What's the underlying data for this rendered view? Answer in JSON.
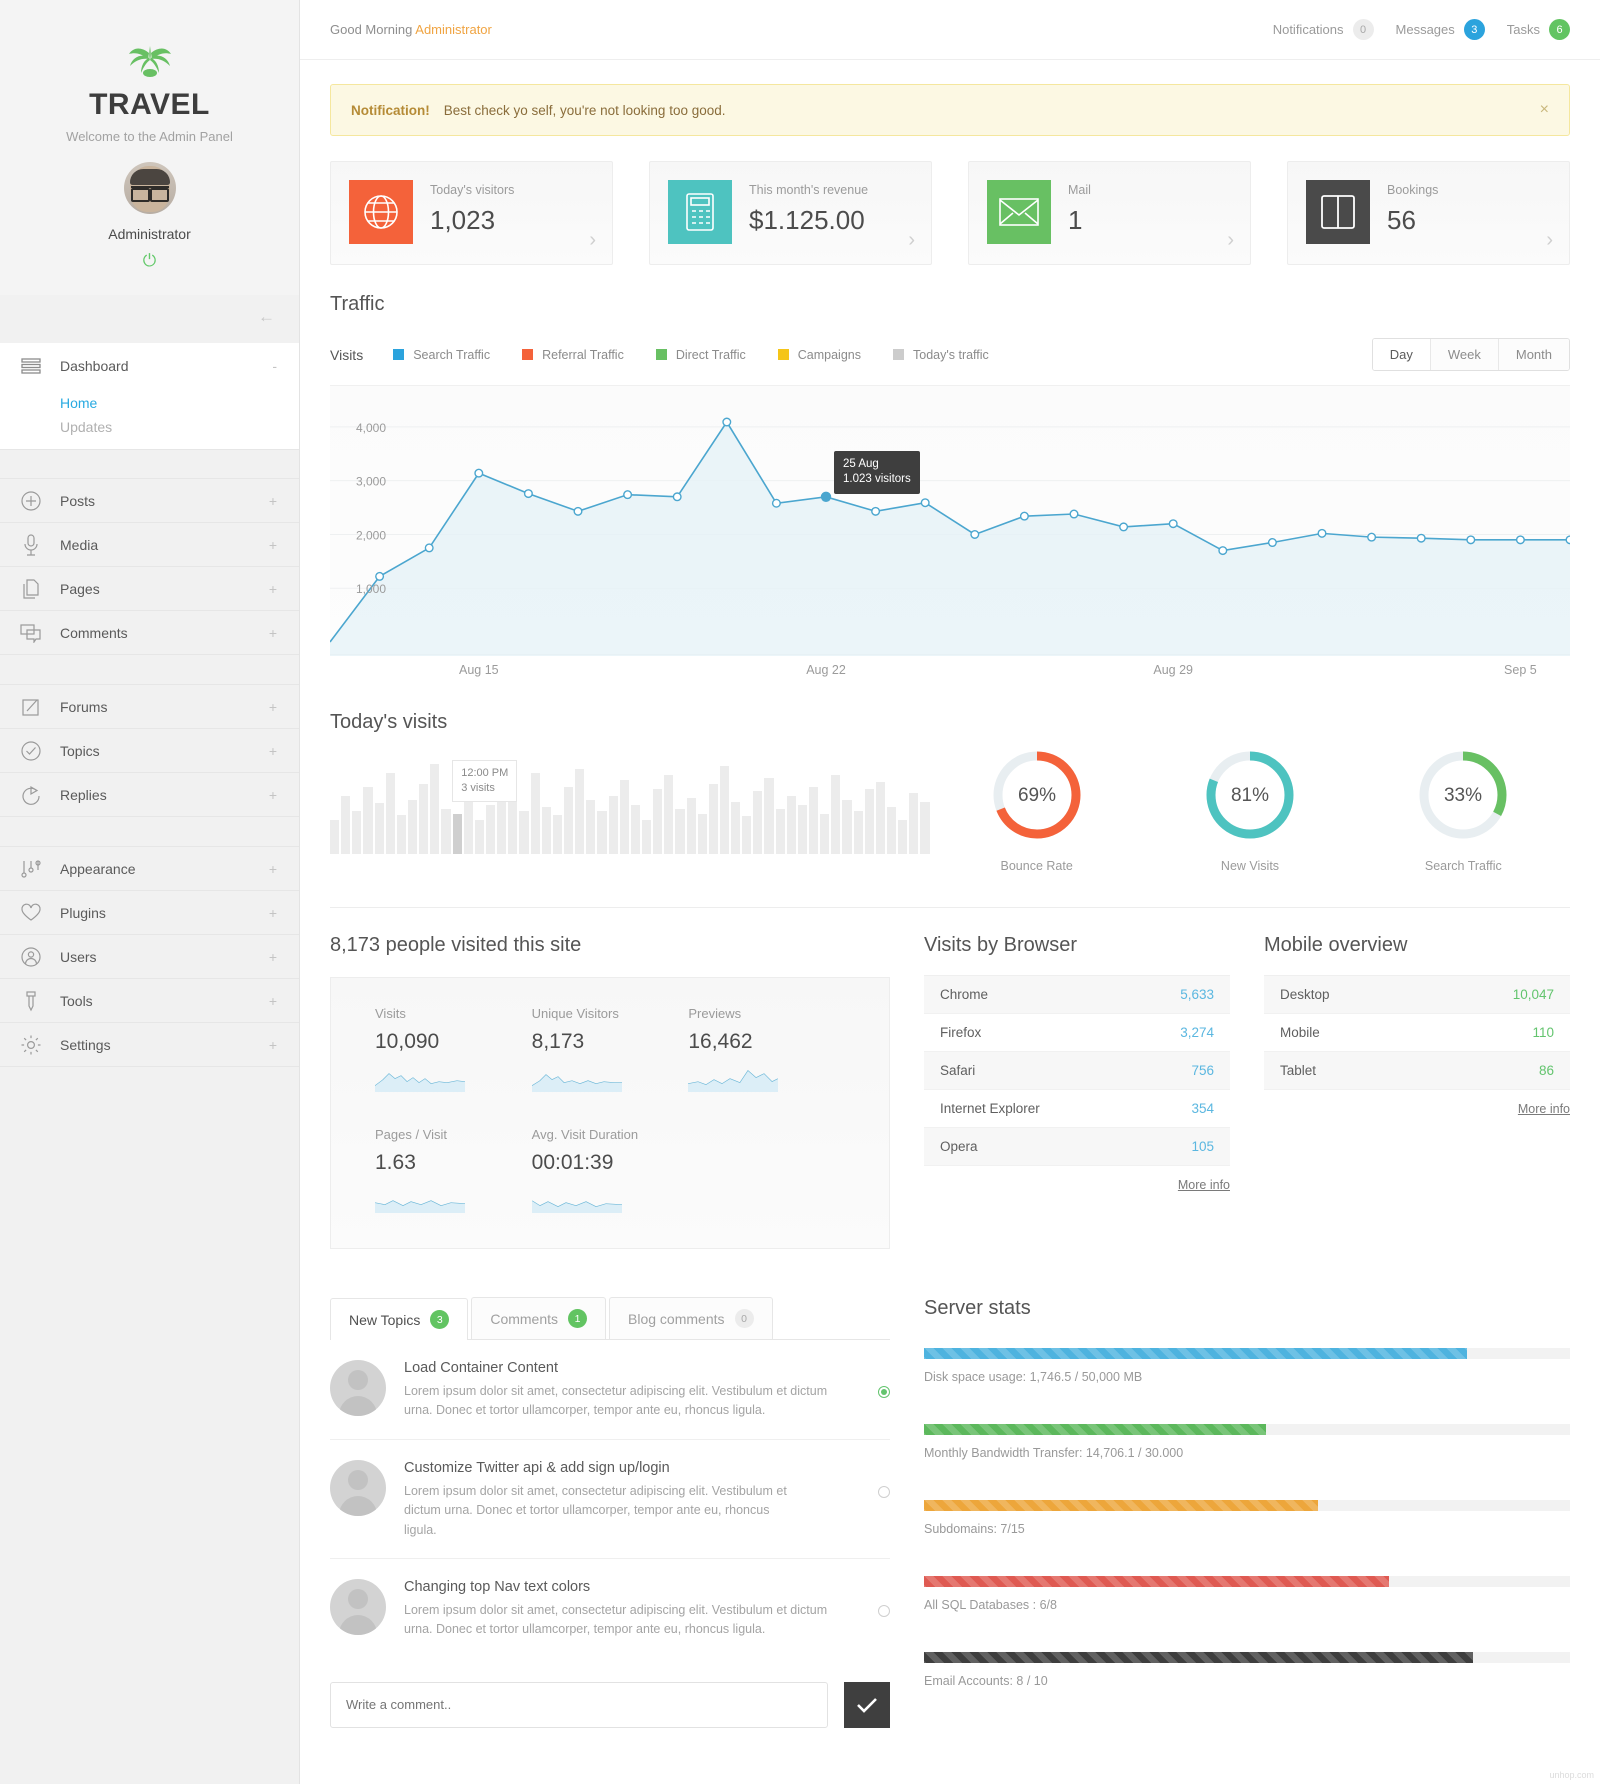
{
  "sidebar": {
    "brand_title": "TRAVEL",
    "brand_sub": "Welcome to the Admin Panel",
    "admin_name": "Administrator",
    "power_icon": "power-icon",
    "collapse_icon": "arrow-left-icon",
    "dashboard": {
      "label": "Dashboard",
      "toggle": "-",
      "icon": "menu-lines-icon"
    },
    "dashboard_sub": [
      {
        "label": "Home",
        "state": "active"
      },
      {
        "label": "Updates",
        "state": "muted"
      }
    ],
    "group1": [
      {
        "label": "Posts",
        "icon": "plus-circle-icon",
        "toggle": "+"
      },
      {
        "label": "Media",
        "icon": "microphone-icon",
        "toggle": "+"
      },
      {
        "label": "Pages",
        "icon": "pages-icon",
        "toggle": "+"
      },
      {
        "label": "Comments",
        "icon": "comments-icon",
        "toggle": "+"
      }
    ],
    "group2": [
      {
        "label": "Forums",
        "icon": "edit-square-icon",
        "toggle": "+"
      },
      {
        "label": "Topics",
        "icon": "check-circle-icon",
        "toggle": "+"
      },
      {
        "label": "Replies",
        "icon": "reply-arrow-icon",
        "toggle": "+"
      }
    ],
    "group3": [
      {
        "label": "Appearance",
        "icon": "sliders-icon",
        "toggle": "+"
      },
      {
        "label": "Plugins",
        "icon": "heart-icon",
        "toggle": "+"
      },
      {
        "label": "Users",
        "icon": "user-circle-icon",
        "toggle": "+"
      },
      {
        "label": "Tools",
        "icon": "tool-icon",
        "toggle": "+"
      },
      {
        "label": "Settings",
        "icon": "gear-icon",
        "toggle": "+"
      }
    ]
  },
  "topbar": {
    "greeting": "Good Morning ",
    "greeting_name": "Administrator",
    "items": [
      {
        "label": "Notifications",
        "count": "0",
        "style": "grey"
      },
      {
        "label": "Messages",
        "count": "3",
        "style": "blue"
      },
      {
        "label": "Tasks",
        "count": "6",
        "style": "green"
      }
    ]
  },
  "alert": {
    "strong": "Notification!",
    "text": "Best check yo self, you're not looking too good.",
    "close_icon": "close-icon"
  },
  "cards": [
    {
      "label": "Today's visitors",
      "value": "1,023",
      "icon": "globe-icon",
      "color": "#f4623a"
    },
    {
      "label": "This month's revenue",
      "value": "$1.125.00",
      "icon": "calculator-icon",
      "color": "#4ec3c0"
    },
    {
      "label": "Mail",
      "value": "1",
      "icon": "envelope-icon",
      "color": "#68c063"
    },
    {
      "label": "Bookings",
      "value": "56",
      "icon": "book-icon",
      "color": "#4a4a4a"
    }
  ],
  "traffic": {
    "title": "Traffic",
    "visits_label": "Visits",
    "legend": [
      {
        "label": "Search Traffic",
        "color": "#2ba3dd"
      },
      {
        "label": "Referral Traffic",
        "color": "#f4623a"
      },
      {
        "label": "Direct Traffic",
        "color": "#68c063"
      },
      {
        "label": "Campaigns",
        "color": "#f5c518"
      },
      {
        "label": "Today's traffic",
        "color": "#cccccc"
      }
    ],
    "range": [
      {
        "label": "Day",
        "selected": true
      },
      {
        "label": "Week",
        "selected": false
      },
      {
        "label": "Month",
        "selected": false
      }
    ],
    "tooltip_date": "25 Aug",
    "tooltip_value": "1.023 visitors"
  },
  "chart_data": {
    "type": "line",
    "title": "Traffic",
    "xlabel": "",
    "ylabel": "Visits",
    "ylim": [
      0,
      4500
    ],
    "yticks": [
      1000,
      2000,
      3000,
      4000
    ],
    "ytick_labels": [
      "1,000",
      "2,000",
      "3,000",
      "4,000"
    ],
    "xtick_labels": [
      "Aug 15",
      "Aug 22",
      "Aug 29",
      "Sep 5"
    ],
    "grid": true,
    "legend_position": "top",
    "series": [
      {
        "name": "Visits",
        "color": "#4ba6cf",
        "x": [
          "Aug 12",
          "Aug 13",
          "Aug 14",
          "Aug 15",
          "Aug 16",
          "Aug 17",
          "Aug 18",
          "Aug 19",
          "Aug 20",
          "Aug 21",
          "Aug 22",
          "Aug 23",
          "Aug 24",
          "Aug 25",
          "Aug 26",
          "Aug 27",
          "Aug 28",
          "Aug 29",
          "Aug 30",
          "Aug 31",
          "Sep 1",
          "Sep 2",
          "Sep 3",
          "Sep 4",
          "Sep 5",
          "Sep 6"
        ],
        "values": [
          0,
          1220,
          1750,
          3140,
          2760,
          2430,
          2740,
          2700,
          4090,
          2580,
          2700,
          2430,
          2590,
          2000,
          2340,
          2380,
          2140,
          2200,
          1700,
          1850,
          2020,
          1950,
          1930,
          1900,
          1900,
          1900
        ],
        "highlight_index": 10,
        "highlight_label": "25 Aug",
        "highlight_value": "1.023 visitors"
      }
    ]
  },
  "todays_visits": {
    "title": "Today's visits",
    "tooltip_time": "12:00 PM",
    "tooltip_value": "3 visits",
    "bars": [
      30,
      52,
      38,
      60,
      45,
      72,
      35,
      48,
      62,
      80,
      40,
      36,
      58,
      30,
      44,
      66,
      50,
      38,
      72,
      42,
      35,
      60,
      76,
      48,
      38,
      52,
      66,
      44,
      30,
      58,
      70,
      40,
      50,
      36,
      62,
      78,
      46,
      34,
      56,
      68,
      40,
      52,
      44,
      60,
      36,
      70,
      48,
      38,
      58,
      64,
      42,
      30,
      54,
      46
    ],
    "highlight_bar_index": 11,
    "donuts": [
      {
        "value": "69%",
        "label": "Bounce Rate",
        "pct": 69,
        "color": "#f4623a"
      },
      {
        "value": "81%",
        "label": "New Visits",
        "pct": 81,
        "color": "#4ec3c0"
      },
      {
        "value": "33%",
        "label": "Search Traffic",
        "pct": 33,
        "color": "#68c063"
      }
    ]
  },
  "people": {
    "headline": "8,173 people visited this site",
    "row1": [
      {
        "label": "Visits",
        "value": "10,090"
      },
      {
        "label": "Unique Visitors",
        "value": "8,173"
      },
      {
        "label": "Previews",
        "value": "16,462"
      }
    ],
    "row2": [
      {
        "label": "Pages / Visit",
        "value": "1.63"
      },
      {
        "label": "Avg. Visit Duration",
        "value": "00:01:39"
      }
    ]
  },
  "browsers": {
    "title": "Visits by Browser",
    "rows": [
      {
        "name": "Chrome",
        "value": "5,633"
      },
      {
        "name": "Firefox",
        "value": "3,274"
      },
      {
        "name": "Safari",
        "value": "756"
      },
      {
        "name": "Internet Explorer",
        "value": "354"
      },
      {
        "name": "Opera",
        "value": "105"
      }
    ],
    "more": "More info"
  },
  "mobile": {
    "title": "Mobile overview",
    "rows": [
      {
        "name": "Desktop",
        "value": "10,047"
      },
      {
        "name": "Mobile",
        "value": "110"
      },
      {
        "name": "Tablet",
        "value": "86"
      }
    ],
    "more": "More info"
  },
  "topics_panel": {
    "tabs": [
      {
        "label": "New Topics",
        "count": "3",
        "style": "green",
        "selected": true
      },
      {
        "label": "Comments",
        "count": "1",
        "style": "green",
        "selected": false
      },
      {
        "label": "Blog comments",
        "count": "0",
        "style": "grey",
        "selected": false
      }
    ],
    "items": [
      {
        "title": "Load Container Content",
        "desc": "Lorem ipsum dolor sit amet, consectetur adipiscing elit. Vestibulum et dictum urna. Donec et tortor ullamcorper, tempor ante eu, rhoncus ligula.",
        "selected": true
      },
      {
        "title": "Customize Twitter api & add sign up/login",
        "desc": "Lorem ipsum dolor sit amet, consectetur adipiscing elit. Vestibulum et dictum urna. Donec et tortor ullamcorper, tempor ante eu, rhoncus ligula.",
        "selected": false
      },
      {
        "title": "Changing top Nav text colors",
        "desc": "Lorem ipsum dolor sit amet, consectetur adipiscing elit. Vestibulum et dictum urna. Donec et tortor ullamcorper, tempor ante eu, rhoncus ligula.",
        "selected": false
      }
    ],
    "comment_placeholder": "Write a comment..",
    "submit_icon": "check-icon"
  },
  "server": {
    "title": "Server stats",
    "items": [
      {
        "label": "Disk space usage: 1,746.5 / 50,000 MB",
        "pct": 84,
        "color": "#4eb3df"
      },
      {
        "label": "Monthly Bandwidth Transfer: 14,706.1 / 30.000",
        "pct": 53,
        "color": "#5cb85c"
      },
      {
        "label": "Subdomains: 7/15",
        "pct": 61,
        "color": "#eda63b"
      },
      {
        "label": "All SQL Databases : 6/8",
        "pct": 72,
        "color": "#df5a52"
      },
      {
        "label": "Email Accounts: 8 / 10",
        "pct": 85,
        "color": "#3e3e3e"
      }
    ]
  },
  "watermark": "unhop.com"
}
